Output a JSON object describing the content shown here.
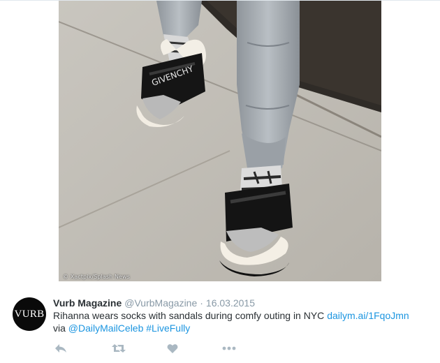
{
  "tweet": {
    "image": {
      "credit": "© Xactpix/Splash News",
      "sandal_text": "GIVENCHY"
    },
    "author": {
      "name": "Vurb Magazine",
      "handle": "@VurbMagazine",
      "avatar_text": "VURB"
    },
    "separator": "·",
    "date": "16.03.2015",
    "text": {
      "main": "Rihanna wears socks with sandals during comfy outing in NYC ",
      "url": "dailym.ai/1FqoJmn",
      "via": "via ",
      "mention": "@DailyMailCeleb",
      "space": " ",
      "hashtag": "#LiveFully"
    },
    "actions": [
      {
        "name": "reply",
        "icon": "reply-icon"
      },
      {
        "name": "retweet",
        "icon": "retweet-icon"
      },
      {
        "name": "like",
        "icon": "heart-icon"
      },
      {
        "name": "more",
        "icon": "more-icon"
      }
    ],
    "colors": {
      "link": "#1b95e0",
      "text": "#292f33",
      "muted": "#8899a6",
      "action_icon": "#aab8c2"
    }
  }
}
